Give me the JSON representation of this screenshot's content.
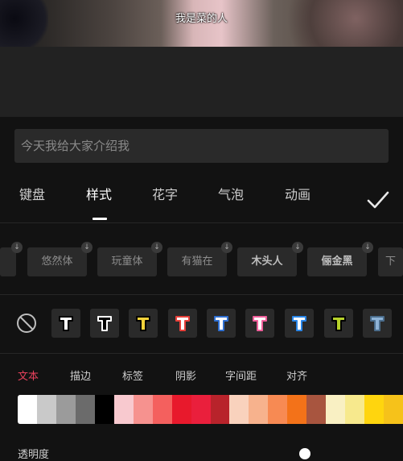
{
  "video": {
    "subtitle": "我是菜的人"
  },
  "input": {
    "value": "今天我给大家介绍我"
  },
  "tabs": [
    {
      "label": "键盘",
      "active": false
    },
    {
      "label": "样式",
      "active": true
    },
    {
      "label": "花字",
      "active": false
    },
    {
      "label": "气泡",
      "active": false
    },
    {
      "label": "动画",
      "active": false
    }
  ],
  "confirm_icon": "check-icon",
  "fonts": [
    "",
    "悠然体",
    "玩童体",
    "有猫在",
    "木头人",
    "俪金黑",
    "下"
  ],
  "preset_colors": [
    {
      "fill": "#ffffff",
      "stroke": "#000000"
    },
    {
      "fill": "#000000",
      "stroke": "#ffffff"
    },
    {
      "fill": "#f5d33a",
      "stroke": "#000000"
    },
    {
      "fill": "#ffffff",
      "stroke": "#e7403a"
    },
    {
      "fill": "#ffffff",
      "stroke": "#2f6fd1"
    },
    {
      "fill": "#ffffff",
      "stroke": "#ee5f9a"
    },
    {
      "fill": "#ffffff",
      "stroke": "#2a86e8"
    },
    {
      "fill": "#b7d22a",
      "stroke": "#000000"
    },
    {
      "fill": "#8fb4d8",
      "stroke": "#4b6d8c"
    }
  ],
  "subtabs": [
    {
      "label": "文本",
      "active": true
    },
    {
      "label": "描边",
      "active": false
    },
    {
      "label": "标签",
      "active": false
    },
    {
      "label": "阴影",
      "active": false
    },
    {
      "label": "字间距",
      "active": false
    },
    {
      "label": "对齐",
      "active": false
    }
  ],
  "swatches": [
    "#ffffff",
    "#c9c9c9",
    "#9b9b9b",
    "#6b6b6b",
    "#000000",
    "#f8c9cf",
    "#f6928f",
    "#f4605e",
    "#e8192c",
    "#ea1f3c",
    "#b8232b",
    "#f9d2bd",
    "#f7b28d",
    "#f78a53",
    "#f37219",
    "#a8553f",
    "#f9f0c3",
    "#f7e98d",
    "#ffd50e",
    "#f6c21a"
  ],
  "opacity_label": "透明度"
}
